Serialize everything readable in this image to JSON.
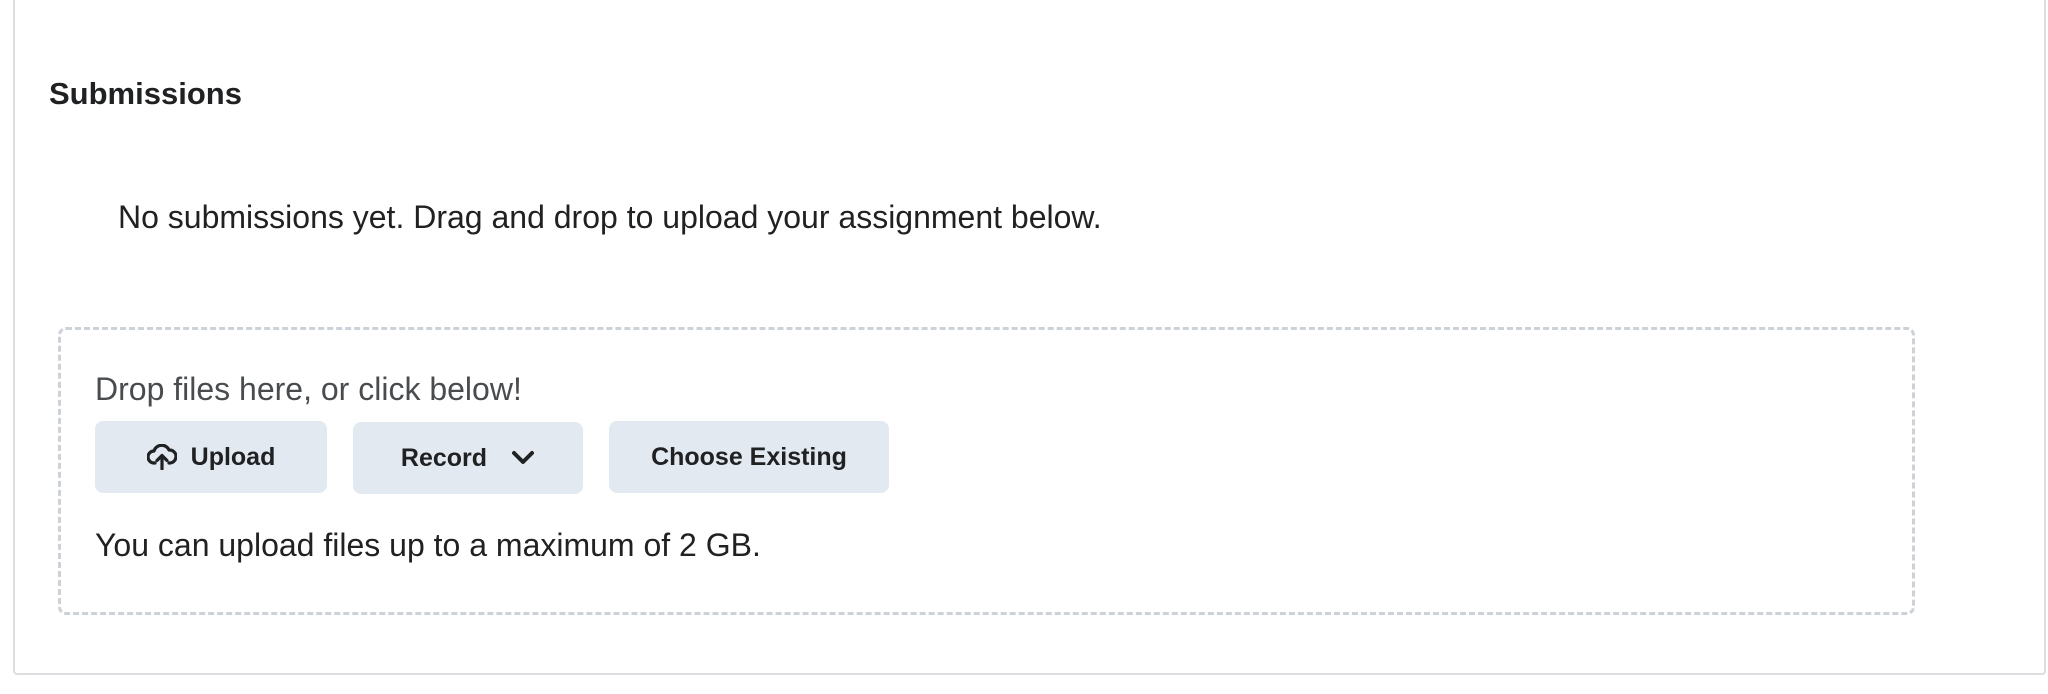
{
  "submissions": {
    "title": "Submissions",
    "empty_message": "No submissions yet. Drag and drop to upload your assignment below."
  },
  "dropzone": {
    "prompt": "Drop files here, or click below!",
    "buttons": {
      "upload_label": "Upload",
      "upload_icon": "cloud-upload-icon",
      "record_label": "Record",
      "record_icon": "chevron-down-icon",
      "choose_existing_label": "Choose Existing"
    },
    "limit_note": "You can upload files up to a maximum of 2 GB."
  },
  "colors": {
    "button_bg": "#e3e9f1",
    "dropzone_border": "#cdd2d8",
    "panel_border": "#dcdde0"
  }
}
